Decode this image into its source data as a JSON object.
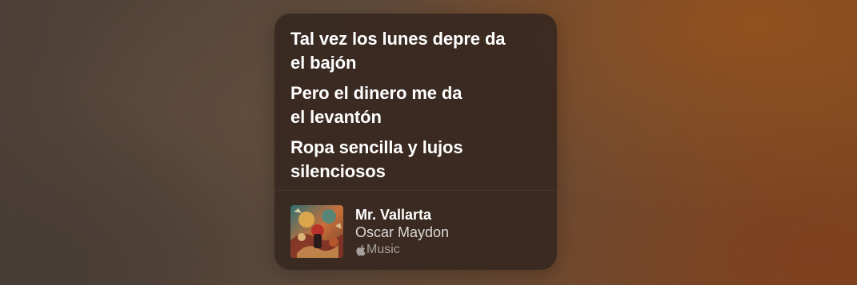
{
  "lyrics": {
    "lines": [
      "Tal vez los lunes depre da\nel bajón",
      "Pero el dinero me da\nel levantón",
      "Ropa sencilla y lujos\nsilenciosos"
    ]
  },
  "track": {
    "title": "Mr. Vallarta",
    "artist": "Oscar Maydon",
    "service_label": "Music",
    "service_icon": "apple-logo-icon",
    "artwork_icon": "album-artwork"
  }
}
